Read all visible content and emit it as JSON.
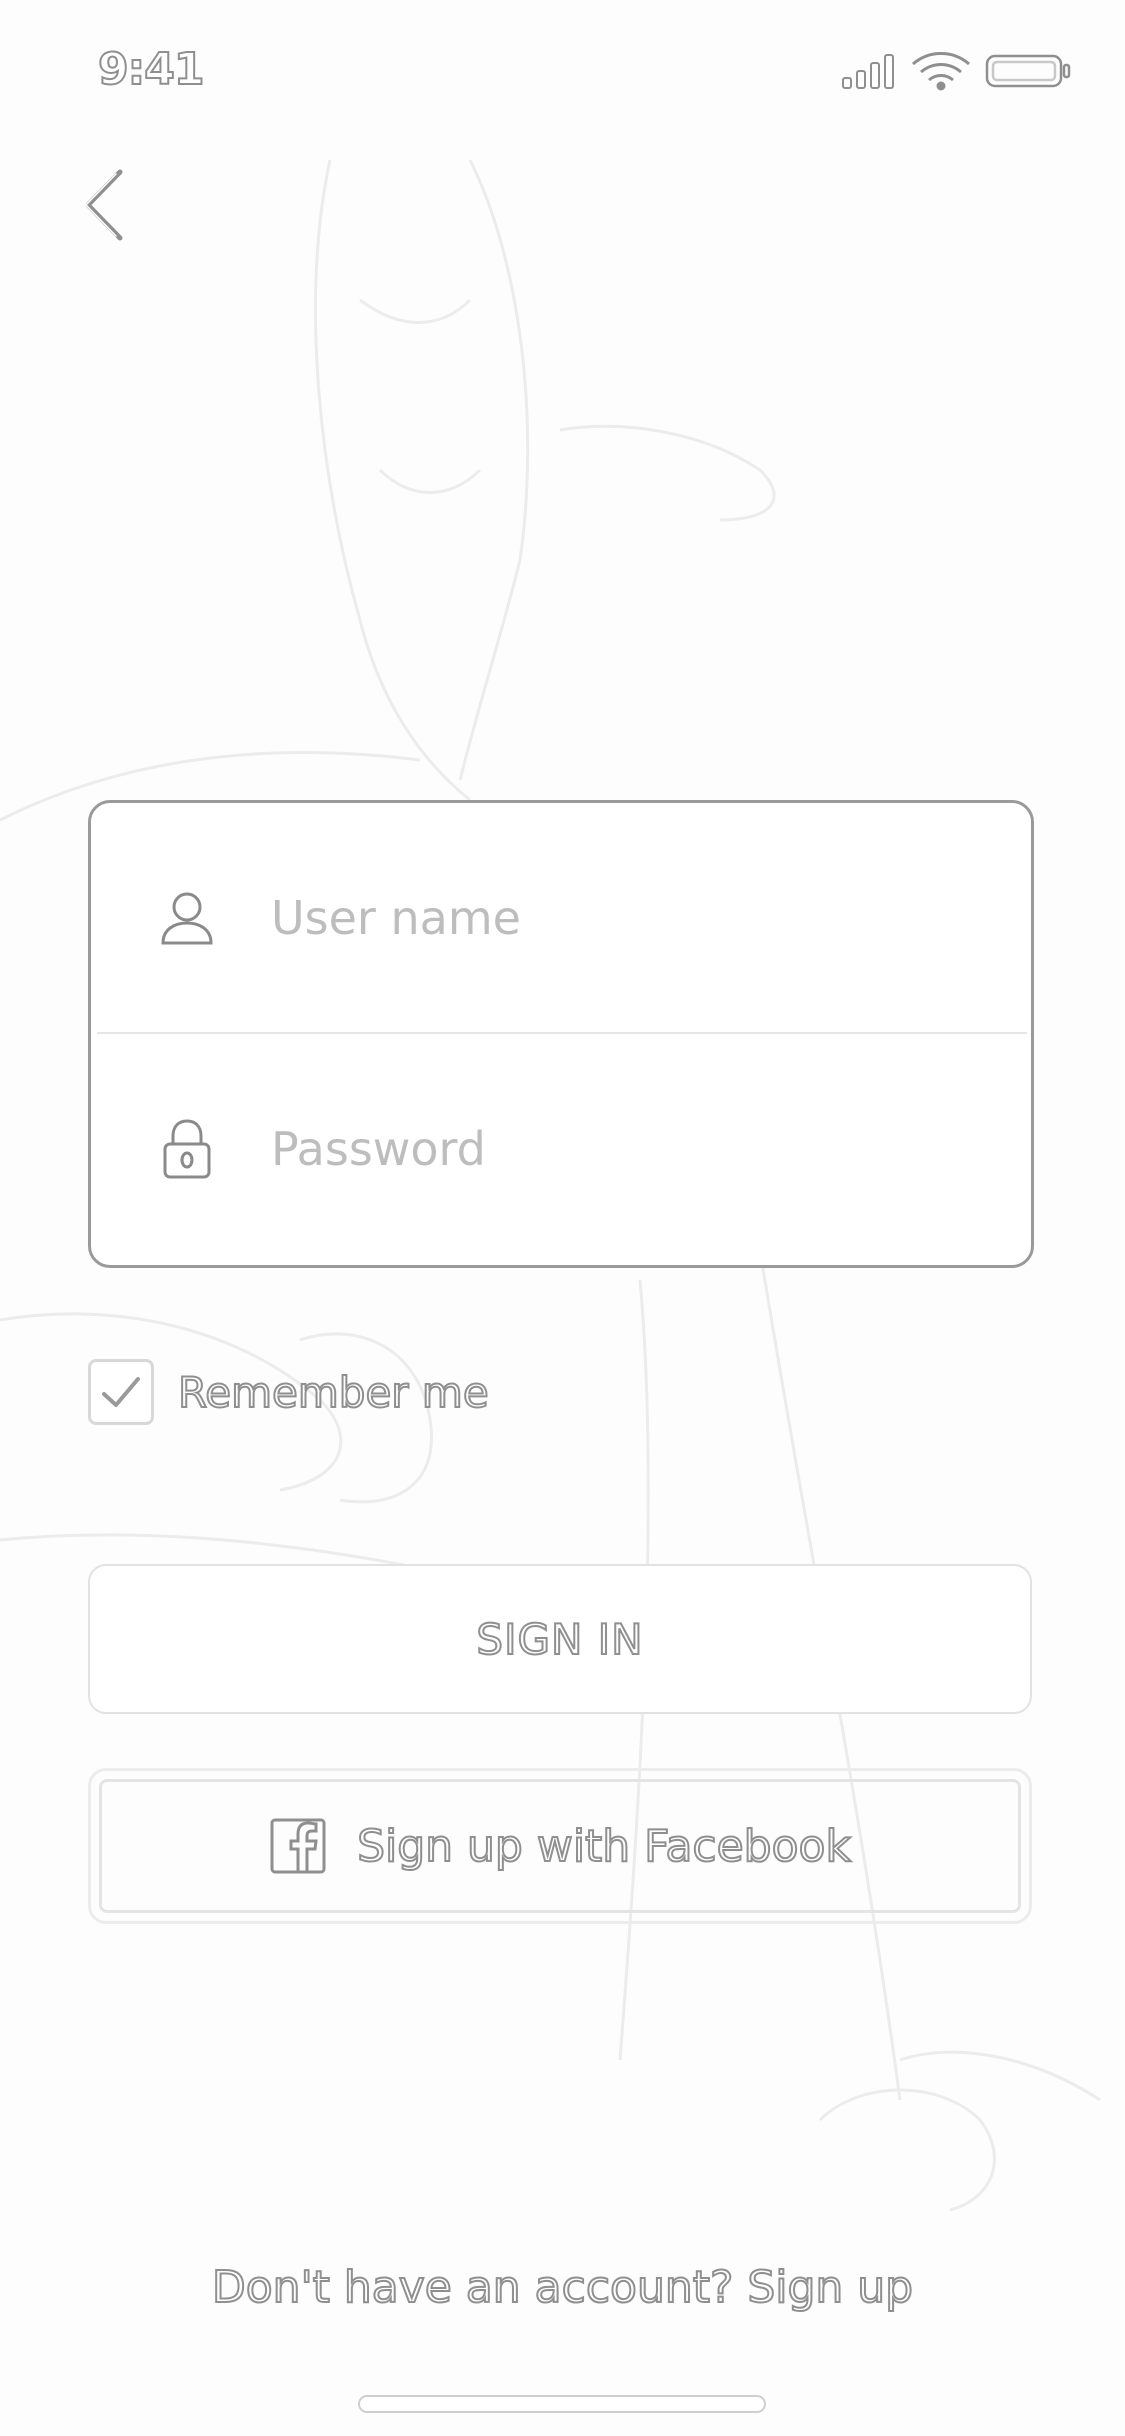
{
  "status_bar": {
    "time": "9:41",
    "icons": [
      "signal-icon",
      "wifi-icon",
      "battery-icon"
    ]
  },
  "nav": {
    "back_icon": "chevron-left-icon"
  },
  "login_form": {
    "username": {
      "icon": "user-icon",
      "placeholder": "User name",
      "value": ""
    },
    "password": {
      "icon": "lock-icon",
      "placeholder": "Password",
      "value": ""
    }
  },
  "remember_me": {
    "label": "Remember me",
    "checked": true
  },
  "actions": {
    "sign_in_label": "SIGN IN",
    "facebook_label": "Sign up with Facebook",
    "facebook_icon": "facebook-icon"
  },
  "footer": {
    "prompt": "Don't have an account?",
    "link": "Sign up"
  },
  "colors": {
    "outline_text": "#8f8f8f",
    "placeholder": "#bdbdbd",
    "card_border": "#9a9a9a",
    "background": "#fdfdfd"
  }
}
